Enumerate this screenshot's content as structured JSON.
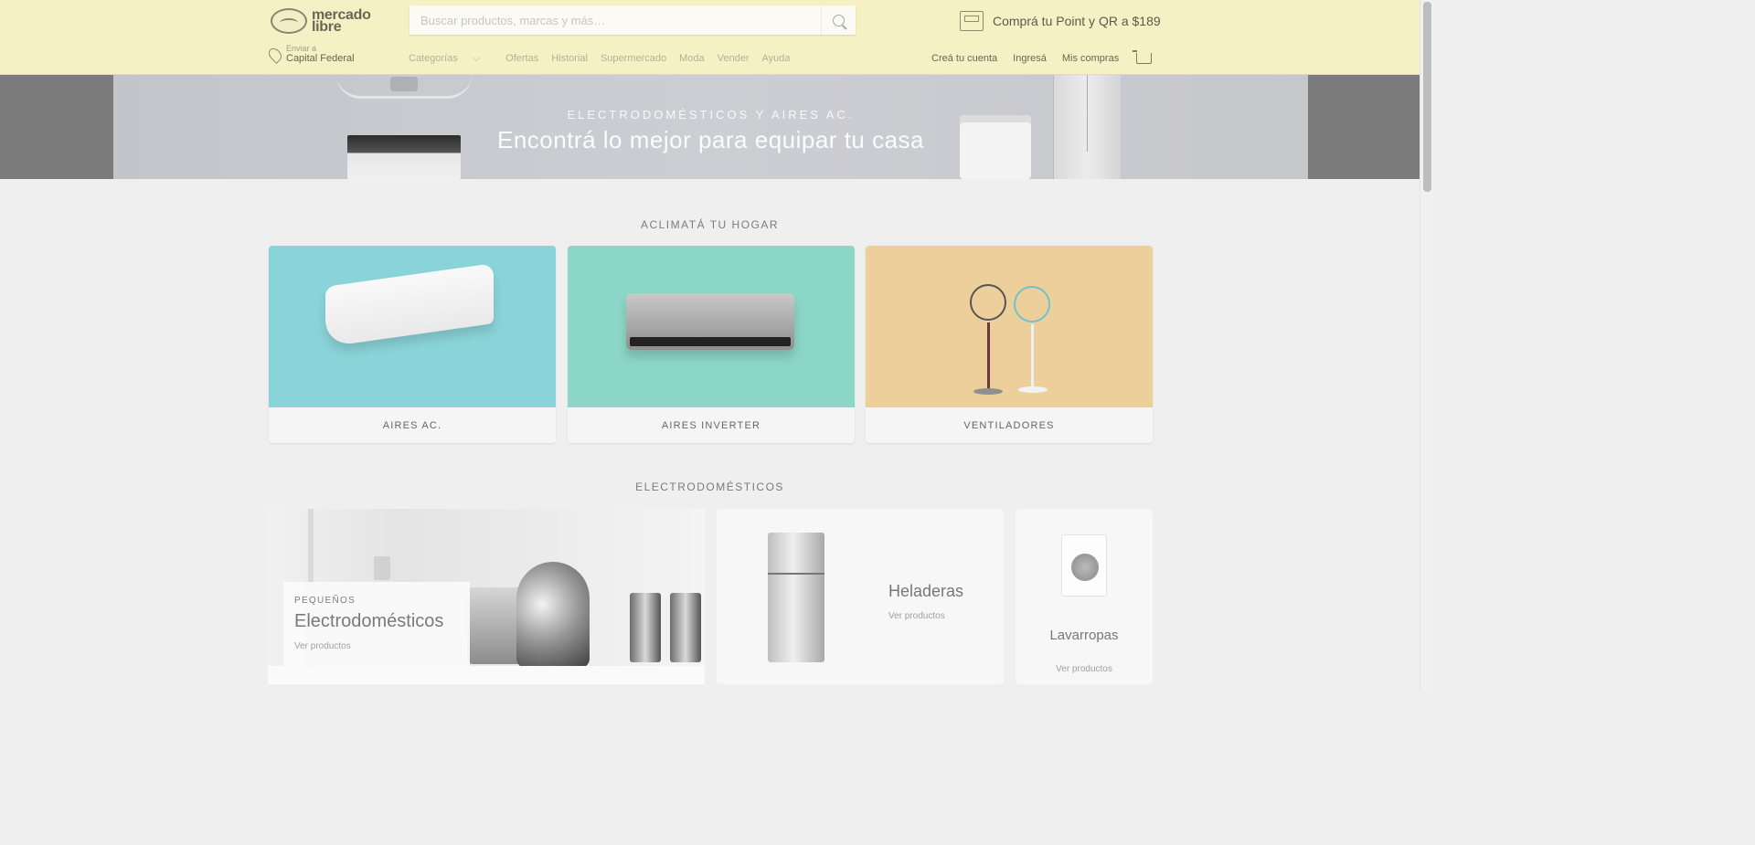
{
  "header": {
    "logo_text": "mercado libre",
    "search_placeholder": "Buscar productos, marcas y más…",
    "promo_text": "Comprá tu Point y QR a $189",
    "location_label": "Enviar a",
    "location_value": "Capital Federal",
    "nav": [
      "Categorías",
      "Ofertas",
      "Historial",
      "Supermercado",
      "Moda",
      "Vender",
      "Ayuda"
    ],
    "account": {
      "create_account": "Creá tu cuenta",
      "login": "Ingresá",
      "purchases": "Mis compras"
    }
  },
  "hero": {
    "subtitle": "ELECTRODOMÉSTICOS Y AIRES AC.",
    "title": "Encontrá lo mejor para equipar tu casa"
  },
  "climate": {
    "title": "ACLIMATÁ TU HOGAR",
    "cards": [
      {
        "label": "AIRES AC.",
        "color": "#8ad3d8"
      },
      {
        "label": "AIRES INVERTER",
        "color": "#8cd6c8"
      },
      {
        "label": "VENTILADORES",
        "color": "#edcf9c"
      }
    ]
  },
  "appliances": {
    "title": "ELECTRODOMÉSTICOS",
    "small": {
      "kicker": "PEQUEÑOS",
      "title": "Electrodomésticos",
      "link": "Ver productos"
    },
    "fridges": {
      "title": "Heladeras",
      "link": "Ver productos"
    },
    "washers": {
      "title": "Lavarropas",
      "link": "Ver productos"
    }
  }
}
